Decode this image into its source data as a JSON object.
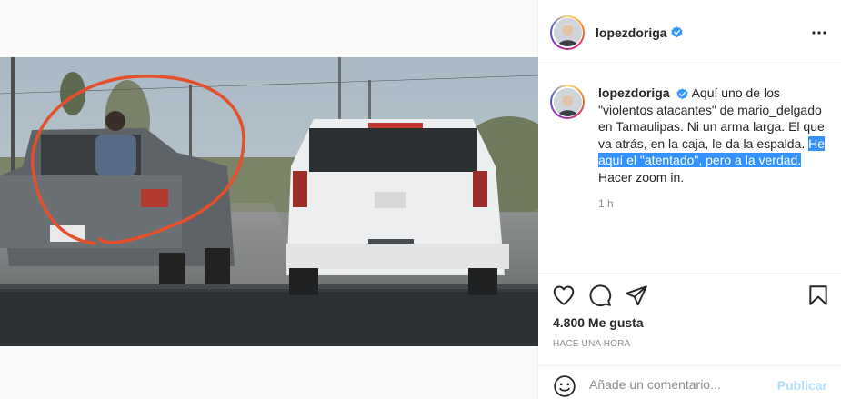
{
  "post": {
    "username": "lopezdoriga",
    "caption_user": "lopezdoriga",
    "caption_text": "Aquí uno de los \"violentos atacantes\" de mario_delgado en Tamaulipas. Ni un arma larga. El que va atrás, en la caja, le da la espalda. ",
    "caption_highlight": "He aquí el \"atentado\", pero a la verdad.",
    "caption_tail": " Hacer zoom in.",
    "comment_time": "1 h",
    "likes": "4.800 Me gusta",
    "posted_ago": "HACE UNA HORA"
  },
  "comment_box": {
    "placeholder": "Añade un comentario...",
    "publish_label": "Publicar"
  },
  "icons": {
    "verified": "verified-badge-icon",
    "more": "more-options-icon",
    "like": "heart-icon",
    "comment": "comment-bubble-icon",
    "share": "paper-plane-icon",
    "save": "bookmark-icon",
    "emoji": "emoji-icon"
  },
  "colors": {
    "verified": "#3897f0",
    "highlight": "#3392ff",
    "publish_disabled": "#b2dffc",
    "annotation_circle": "#e4502c"
  }
}
